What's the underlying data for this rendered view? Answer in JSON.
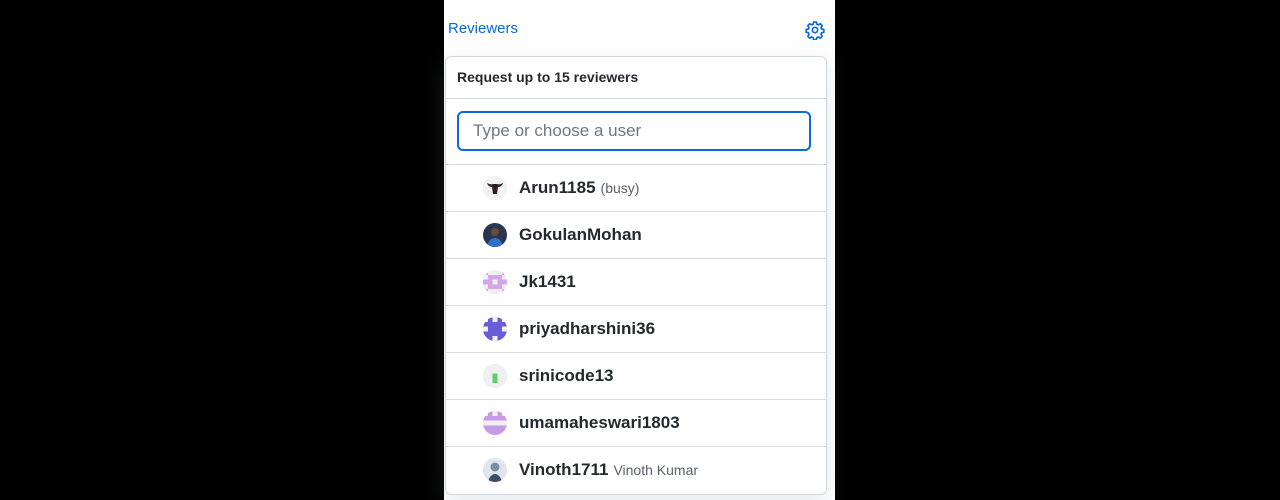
{
  "sidebar": {
    "title": "Reviewers",
    "settings_icon": "gear-icon",
    "accent_color": "#0969da"
  },
  "popover": {
    "title": "Request up to 15 reviewers",
    "filter": {
      "placeholder": "Type or choose a user",
      "value": ""
    },
    "users": [
      {
        "login": "Arun1185",
        "meta": "(busy)",
        "avatar": "bull-avatar"
      },
      {
        "login": "GokulanMohan",
        "meta": "",
        "avatar": "photo-avatar"
      },
      {
        "login": "Jk1431",
        "meta": "",
        "avatar": "identicon-pink"
      },
      {
        "login": "priyadharshini36",
        "meta": "",
        "avatar": "identicon-indigo"
      },
      {
        "login": "srinicode13",
        "meta": "",
        "avatar": "identicon-green"
      },
      {
        "login": "umamaheswari1803",
        "meta": "",
        "avatar": "identicon-lilac"
      },
      {
        "login": "Vinoth1711",
        "meta": "Vinoth Kumar",
        "avatar": "photo-avatar"
      }
    ]
  }
}
